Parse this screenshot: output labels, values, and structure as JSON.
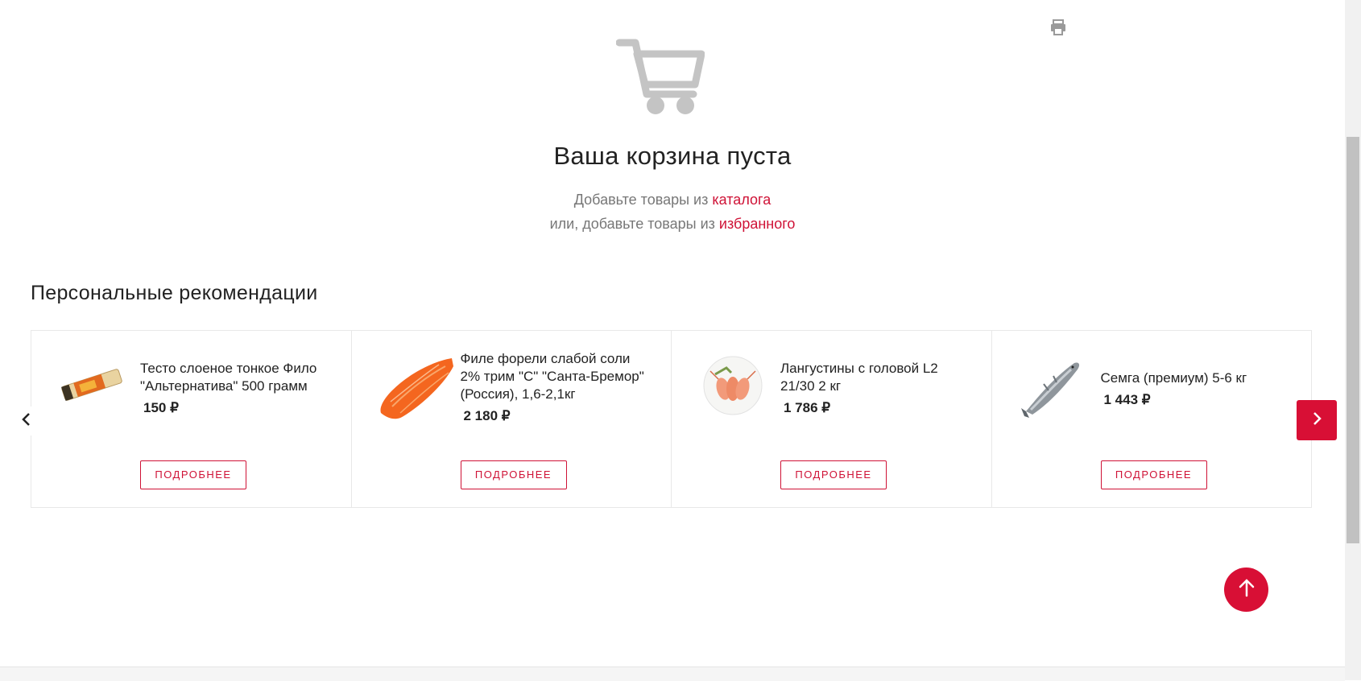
{
  "cart": {
    "empty_title": "Ваша корзина пуста",
    "line1_text": "Добавьте товары из",
    "line1_link": "каталога",
    "line2_text": "или, добавьте товары из",
    "line2_link": "избранного"
  },
  "recommendations": {
    "title": "Персональные рекомендации",
    "items": [
      {
        "name": "Тесто слоеное тонкое Фило \"Альтернатива\" 500 грамм",
        "price": "150 ₽",
        "button": "ПОДРОБНЕЕ",
        "image_icon": "phyllo-dough-package"
      },
      {
        "name": "Филе форели слабой соли 2% трим \"С\" \"Санта-Бремор\" (Россия), 1,6-2,1кг",
        "price": "2 180 ₽",
        "button": "ПОДРОБНЕЕ",
        "image_icon": "trout-fillet"
      },
      {
        "name": "Лангустины с головой L2 21/30 2 кг",
        "price": "1 786 ₽",
        "button": "ПОДРОБНЕЕ",
        "image_icon": "langoustines-plate"
      },
      {
        "name": "Семга (премиум) 5-6 кг",
        "price": "1 443 ₽",
        "button": "ПОДРОБНЕЕ",
        "image_icon": "whole-salmon"
      }
    ]
  },
  "colors": {
    "accent": "#d80f35",
    "link": "#cf1236",
    "icon_gray": "#c4c4c4"
  },
  "icons": {
    "print": "print-icon",
    "cart": "cart-icon",
    "prev": "chevron-left-icon",
    "next": "chevron-right-icon",
    "scroll_top": "arrow-up-icon"
  }
}
